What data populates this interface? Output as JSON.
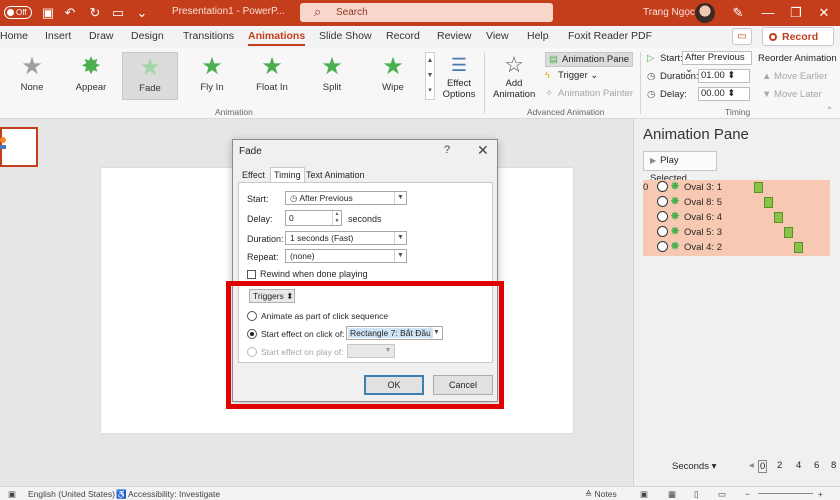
{
  "titlebar": {
    "autosave": "Off",
    "document": "Presentation1 - PowerP...",
    "search_placeholder": "Search",
    "user": "Trang Ngọc"
  },
  "tabs": [
    "Home",
    "Insert",
    "Draw",
    "Design",
    "Transitions",
    "Animations",
    "Slide Show",
    "Record",
    "Review",
    "View",
    "Help",
    "Foxit Reader PDF"
  ],
  "active_tab": "Animations",
  "record_label": "Record",
  "ribbon": {
    "animations": [
      "None",
      "Appear",
      "Fade",
      "Fly In",
      "Float In",
      "Split",
      "Wipe"
    ],
    "selected_animation": "Fade",
    "effect_options": [
      "Effect",
      "Options"
    ],
    "group_animation": "Animation",
    "add_animation": [
      "Add",
      "Animation"
    ],
    "animation_pane": "Animation Pane",
    "trigger": "Trigger",
    "animation_painter": "Animation Painter",
    "group_advanced": "Advanced Animation",
    "start_label": "Start:",
    "start_value": "After Previous",
    "duration_label": "Duration:",
    "duration_value": "01.00",
    "delay_label": "Delay:",
    "delay_value": "00.00",
    "reorder_title": "Reorder Animation",
    "move_earlier": "Move Earlier",
    "move_later": "Move Later",
    "group_timing": "Timing"
  },
  "pane": {
    "title": "Animation Pane",
    "play_selected": "Play Selected",
    "first_number": "0",
    "items": [
      "Oval 3: 1",
      "Oval 8: 5",
      "Oval 6: 4",
      "Oval 5: 3",
      "Oval 4: 2"
    ],
    "timeline_fraction": [
      0.0,
      0.2,
      0.4,
      0.6,
      0.8
    ],
    "seconds_label": "Seconds",
    "scale": [
      "0",
      "2",
      "4",
      "6",
      "8"
    ]
  },
  "dialog": {
    "title": "Fade",
    "help": "?",
    "tabs": [
      "Effect",
      "Timing",
      "Text Animation"
    ],
    "active_tab": "Timing",
    "start_label": "Start:",
    "start_value": "After Previous",
    "delay_label": "Delay:",
    "delay_value": "0",
    "delay_unit": "seconds",
    "duration_label": "Duration:",
    "duration_value": "1 seconds (Fast)",
    "repeat_label": "Repeat:",
    "repeat_value": "(none)",
    "rewind_label": "Rewind when done playing",
    "rewind_checked": false,
    "triggers_label": "Triggers",
    "opt_click_sequence": "Animate as part of click sequence",
    "opt_click_of": "Start effect on click of:",
    "click_of_value": "Rectangle 7: Bắt Đầu",
    "opt_play_of": "Start effect on play of:",
    "selected_option": "click_of",
    "ok": "OK",
    "cancel": "Cancel"
  },
  "status": {
    "language": "English (United States)",
    "accessibility": "Accessibility: Investigate",
    "notes": "Notes"
  },
  "colors": {
    "accent": "#c43e1c",
    "highlight_box": "#e00000",
    "pane_selection": "#f8c9b2",
    "timeline_bar": "#8bc34a"
  }
}
